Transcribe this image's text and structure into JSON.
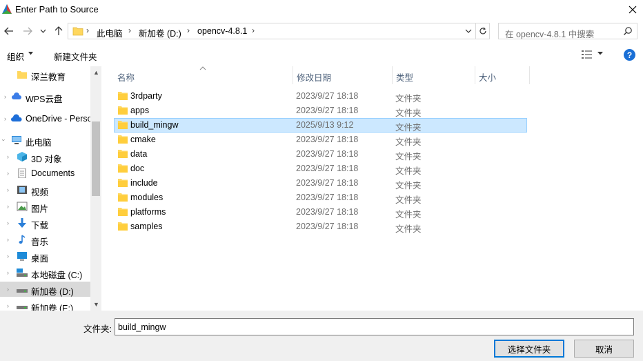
{
  "window": {
    "title": "Enter Path to Source",
    "close_icon": "close-icon",
    "app_icon": "cmake-triangle-icon"
  },
  "navigation": {
    "back_icon": "arrow-left-icon",
    "forward_icon": "arrow-right-icon",
    "recent_icon": "chevron-down-icon",
    "up_icon": "arrow-up-icon"
  },
  "address": {
    "crumbs": [
      "此电脑",
      "新加卷 (D:)",
      "opencv-4.8.1"
    ],
    "refresh_icon": "refresh-icon"
  },
  "search": {
    "placeholder": "在 opencv-4.8.1 中搜索"
  },
  "toolbar": {
    "organize_label": "组织",
    "new_folder_label": "新建文件夹",
    "help_label": "?"
  },
  "nav_pane": {
    "items": [
      {
        "label": "深兰教育",
        "icon": "folder-icon"
      },
      {
        "label": "WPS云盘",
        "icon": "cloud-icon"
      },
      {
        "label": "OneDrive - Perso",
        "icon": "onedrive-cloud-icon"
      },
      {
        "label": "此电脑",
        "icon": "computer-icon"
      },
      {
        "label": "3D 对象",
        "icon": "cube-icon"
      },
      {
        "label": "Documents",
        "icon": "document-icon"
      },
      {
        "label": "视频",
        "icon": "video-icon"
      },
      {
        "label": "图片",
        "icon": "picture-icon"
      },
      {
        "label": "下载",
        "icon": "download-icon"
      },
      {
        "label": "音乐",
        "icon": "music-icon"
      },
      {
        "label": "桌面",
        "icon": "desktop-icon"
      },
      {
        "label": "本地磁盘 (C:)",
        "icon": "drive-icon"
      },
      {
        "label": "新加卷 (D:)",
        "icon": "drive-icon"
      },
      {
        "label": "新加卷 (E:)",
        "icon": "drive-icon"
      }
    ],
    "selected_label": "新加卷 (D:)"
  },
  "file_list": {
    "columns": [
      "名称",
      "修改日期",
      "类型",
      "大小"
    ],
    "rows": [
      {
        "name": "3rdparty",
        "date": "2023/9/27 18:18",
        "type": "文件夹"
      },
      {
        "name": "apps",
        "date": "2023/9/27 18:18",
        "type": "文件夹"
      },
      {
        "name": "build_mingw",
        "date": "2025/9/13 9:12",
        "type": "文件夹"
      },
      {
        "name": "cmake",
        "date": "2023/9/27 18:18",
        "type": "文件夹"
      },
      {
        "name": "data",
        "date": "2023/9/27 18:18",
        "type": "文件夹"
      },
      {
        "name": "doc",
        "date": "2023/9/27 18:18",
        "type": "文件夹"
      },
      {
        "name": "include",
        "date": "2023/9/27 18:18",
        "type": "文件夹"
      },
      {
        "name": "modules",
        "date": "2023/9/27 18:18",
        "type": "文件夹"
      },
      {
        "name": "platforms",
        "date": "2023/9/27 18:18",
        "type": "文件夹"
      },
      {
        "name": "samples",
        "date": "2023/9/27 18:18",
        "type": "文件夹"
      }
    ],
    "selected_name": "build_mingw"
  },
  "footer": {
    "folder_label": "文件夹:",
    "folder_value": "build_mingw",
    "select_button": "选择文件夹",
    "cancel_button": "取消"
  },
  "colors": {
    "selection_bg": "#cce8ff",
    "selection_border": "#99d1ff",
    "folder_yellow": "#ffd75e",
    "accent_blue": "#0078d7"
  }
}
